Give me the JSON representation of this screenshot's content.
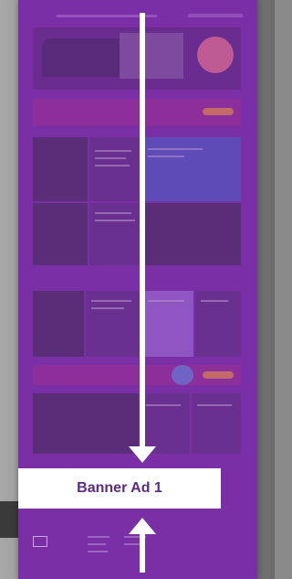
{
  "banner": {
    "label": "Banner Ad 1"
  },
  "colors": {
    "overlay_purple": "#7b2fa6",
    "banner_bg": "#ffffff",
    "banner_text": "#5b2a86",
    "arrow": "#ffffff",
    "background": "#8a8a8a"
  },
  "icons": {
    "arrow_down": "arrow-down-icon",
    "arrow_up": "arrow-up-icon"
  }
}
